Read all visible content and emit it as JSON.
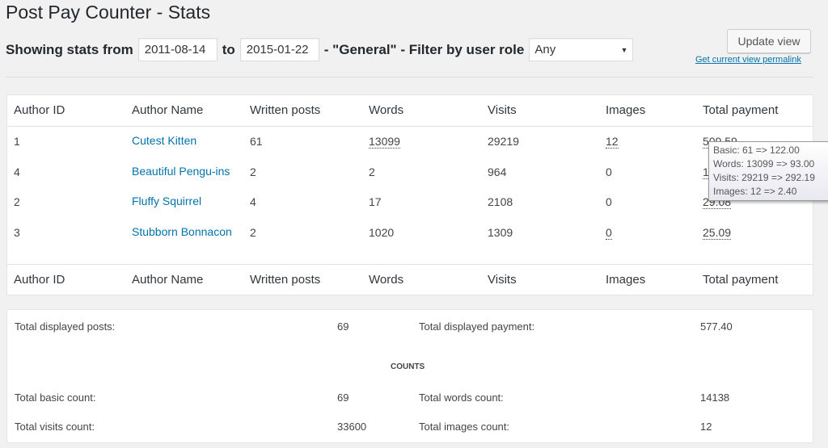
{
  "title": "Post Pay Counter - Stats",
  "filter": {
    "prefix": "Showing stats from",
    "from": "2011-08-14",
    "to_label": "to",
    "to": "2015-01-22",
    "middle": "- \"General\" - Filter by user role",
    "role": "Any"
  },
  "update_button": "Update view",
  "permalink": "Get current view permalink",
  "table": {
    "headers": [
      "Author ID",
      "Author Name",
      "Written posts",
      "Words",
      "Visits",
      "Images",
      "Total payment"
    ],
    "rows": [
      {
        "id": "1",
        "name": "Cutest Kitten",
        "posts": "61",
        "words": "13099",
        "visits": "29219",
        "images": "12",
        "payment": "509.59"
      },
      {
        "id": "4",
        "name": "Beautiful Pengu-ins",
        "posts": "2",
        "words": "2",
        "visits": "964",
        "images": "0",
        "payment": "13.64"
      },
      {
        "id": "2",
        "name": "Fluffy Squirrel",
        "posts": "4",
        "words": "17",
        "visits": "2108",
        "images": "0",
        "payment": "29.08"
      },
      {
        "id": "3",
        "name": "Stubborn Bonnacon",
        "posts": "2",
        "words": "1020",
        "visits": "1309",
        "images": "0",
        "payment": "25.09"
      }
    ]
  },
  "tooltip": [
    "Basic: 61 => 122.00",
    "Words: 13099 => 93.00",
    "Visits: 29219 => 292.19",
    "Images: 12 => 2.40"
  ],
  "summary": {
    "posts_label": "Total displayed posts:",
    "posts": "69",
    "payment_label": "Total displayed payment:",
    "payment": "577.40",
    "counts_heading": "COUNTS",
    "basic_label": "Total basic count:",
    "basic": "69",
    "words_label": "Total words count:",
    "words": "14138",
    "visits_label": "Total visits count:",
    "visits": "33600",
    "images_label": "Total images count:",
    "images": "12"
  }
}
